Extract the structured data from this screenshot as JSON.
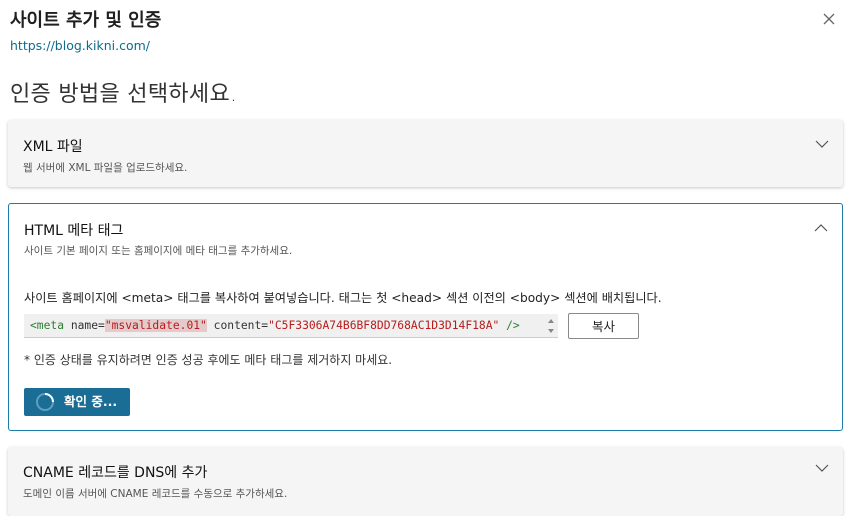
{
  "dialog": {
    "title": "사이트 추가 및 인증",
    "url": "https://blog.kikni.com/",
    "heading": "인증 방법을 선택하세요."
  },
  "cards": {
    "xml": {
      "title": "XML 파일",
      "desc": "웹 서버에 XML 파일을 업로드하세요."
    },
    "html": {
      "title": "HTML 메타 태그",
      "desc": "사이트 기본 페이지 또는 홈페이지에 메타 태그를 추가하세요.",
      "instruction": "사이트 홈페이지에 <meta> 태그를 복사하여 붙여넣습니다. 태그는 첫 <head> 섹션 이전의 <body> 섹션에 배치됩니다.",
      "code": {
        "open": "<meta ",
        "name_attr": "name=",
        "name_value": "\"msvalidate.01\"",
        "content_attr": " content=",
        "content_value": "\"C5F3306A74B6BF8DD768AC1D3D14F18A\"",
        "close": " />"
      },
      "copy_label": "복사",
      "note": "* 인증 상태를 유지하려면 인증 성공 후에도 메타 태그를 제거하지 마세요.",
      "verify_label": "확인 중..."
    },
    "cname": {
      "title": "CNAME 레코드를 DNS에 추가",
      "desc": "도메인 이름 서버에 CNAME 레코드를 수동으로 추가하세요."
    }
  },
  "colors": {
    "accent": "#1a6e95",
    "link": "#0f6c8a",
    "active_border": "#1b7bab"
  },
  "icons": {
    "close": "close-icon",
    "expand": "chevron-down-icon",
    "collapse": "chevron-up-icon",
    "loading": "spinner-icon"
  }
}
